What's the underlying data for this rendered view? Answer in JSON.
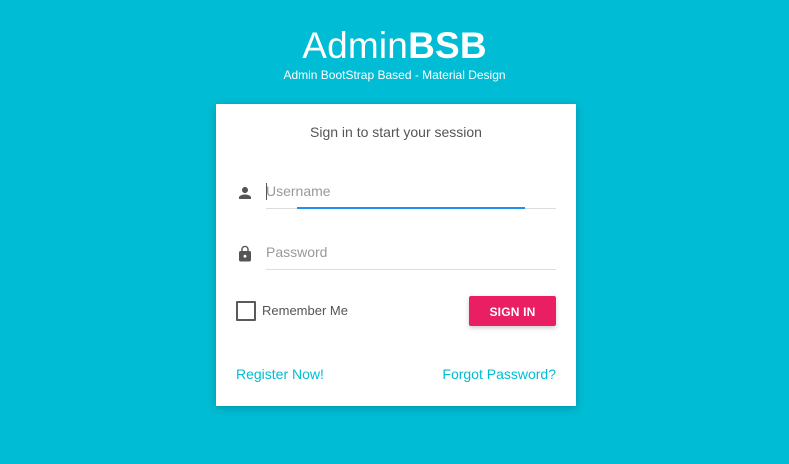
{
  "brand": {
    "title_regular": "Admin",
    "title_bold": "BSB",
    "subtitle": "Admin BootStrap Based - Material Design"
  },
  "login_card": {
    "message": "Sign in to start your session",
    "username": {
      "value": "",
      "placeholder": "Username",
      "icon": "person-icon"
    },
    "password": {
      "value": "",
      "placeholder": "Password",
      "icon": "lock-icon"
    },
    "remember_me_label": "Remember Me",
    "remember_me_checked": false,
    "sign_in_label": "SIGN IN",
    "register_link": "Register Now!",
    "forgot_link": "Forgot Password?"
  },
  "colors": {
    "background": "#00bcd4",
    "primary_button": "#e91e63",
    "focus_underline": "#1f91f3",
    "link": "#00bcd4"
  }
}
